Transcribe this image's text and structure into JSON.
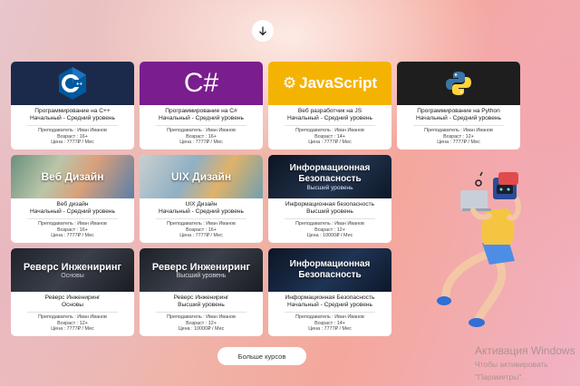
{
  "more_button": "Больше курсов",
  "activation": {
    "line1": "Активация Windows",
    "line2": "Чтобы активировать",
    "line3": "\"Параметры\"."
  },
  "courses": [
    {
      "thumb_text": "",
      "thumb_sub": "",
      "title": "Программирование на C++",
      "level": "Начальный - Средний уровень",
      "teacher": "Преподаватель : Иван Иванов",
      "age": "Возраст : 16+",
      "price": "Цена : 7777₽ / Мес"
    },
    {
      "thumb_text": "C#",
      "thumb_sub": "",
      "title": "Программирование на C#",
      "level": "Начальный - Средний уровень",
      "teacher": "Преподаватель : Иван Иванов",
      "age": "Возраст : 16+",
      "price": "Цена : 7777₽ / Мес"
    },
    {
      "thumb_text": "JavaScript",
      "thumb_sub": "",
      "title": "Веб разработчик на JS",
      "level": "Начальный - Средний уровень",
      "teacher": "Преподаватель : Иван Иванов",
      "age": "Возраст : 14+",
      "price": "Цена : 7777₽ / Мес"
    },
    {
      "thumb_text": "",
      "thumb_sub": "",
      "title": "Программирование на Python",
      "level": "Начальный - Средний уровень",
      "teacher": "Преподаватель : Иван Иванов",
      "age": "Возраст : 12+",
      "price": "Цена : 7777₽ / Мес"
    },
    {
      "thumb_text": "Веб Дизайн",
      "thumb_sub": "",
      "title": "Веб дизайн",
      "level": "Начальный - Средний уровень",
      "teacher": "Преподаватель : Иван Иванов",
      "age": "Возраст : 16+",
      "price": "Цена : 7777₽ / Мес"
    },
    {
      "thumb_text": "UIX Дизайн",
      "thumb_sub": "",
      "title": "UIX Дизайн",
      "level": "Начальный - Средний уровень",
      "teacher": "Преподаватель : Иван Иванов",
      "age": "Возраст : 16+",
      "price": "Цена : 7777₽ / Мес"
    },
    {
      "thumb_text": "Информационная Безопасность",
      "thumb_sub": "Высший уровень",
      "title": "Информационная безопасность",
      "level": "Высший уровень",
      "teacher": "Преподаватель : Иван Иванов",
      "age": "Возраст : 12+",
      "price": "Цена : 10000₽ / Мес"
    },
    {
      "thumb_text": "Реверс Инжениринг",
      "thumb_sub": "Основы",
      "title": "Реверс Инжениринг",
      "level": "Основы",
      "teacher": "Преподаватель : Иван Иванов",
      "age": "Возраст : 12+",
      "price": "Цена : 7777₽ / Мес"
    },
    {
      "thumb_text": "Реверс Инжениринг",
      "thumb_sub": "Высший уровень",
      "title": "Реверс Инжениринг",
      "level": "Высший уровень",
      "teacher": "Преподаватель : Иван Иванов",
      "age": "Возраст : 12+",
      "price": "Цена : 10000₽ / Мес"
    },
    {
      "thumb_text": "Информационная Безопасность",
      "thumb_sub": "",
      "title": "Информационная Безопасность",
      "level": "Начальный - Средний уровень",
      "teacher": "Преподаватель : Иван Иванов",
      "age": "Возраст : 14+",
      "price": "Цена : 7777₽ / Мес"
    }
  ]
}
